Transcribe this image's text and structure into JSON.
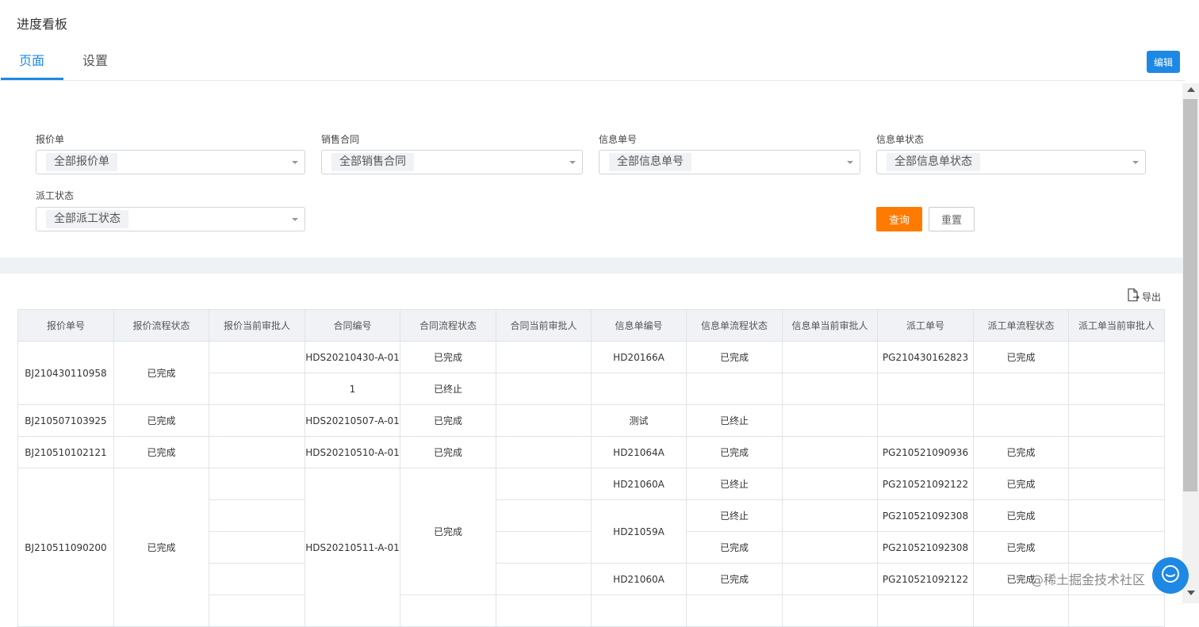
{
  "page_title": "进度看板",
  "tabs": [
    {
      "label": "页面",
      "active": true
    },
    {
      "label": "设置",
      "active": false
    }
  ],
  "edit_label": "编辑",
  "filters": {
    "quote": {
      "label": "报价单",
      "value": "全部报价单"
    },
    "contract": {
      "label": "销售合同",
      "value": "全部销售合同"
    },
    "info_no": {
      "label": "信息单号",
      "value": "全部信息单号"
    },
    "info_status": {
      "label": "信息单状态",
      "value": "全部信息单状态"
    },
    "dispatch_status": {
      "label": "派工状态",
      "value": "全部派工状态"
    }
  },
  "query_label": "查询",
  "reset_label": "重置",
  "export_label": "导出",
  "accent_color": "#1e88e5",
  "query_color": "#ff7a00",
  "table": {
    "columns": [
      "报价单号",
      "报价流程状态",
      "报价当前审批人",
      "合同编号",
      "合同流程状态",
      "合同当前审批人",
      "信息单编号",
      "信息单流程状态",
      "信息单当前审批人",
      "派工单号",
      "派工单流程状态",
      "派工单当前审批人"
    ],
    "rows": [
      {
        "quote_no": "BJ210430110958",
        "quote_status": "已完成",
        "contracts": [
          {
            "no": "HDS20210430-A-01",
            "status": "已完成",
            "infos": [
              {
                "no": "HD20166A",
                "status": "已完成",
                "dispatches": [
                  {
                    "no": "PG210430162823",
                    "status": "已完成"
                  }
                ]
              }
            ]
          },
          {
            "no": "1",
            "status": "已终止",
            "infos": [
              {
                "no": "",
                "status": "",
                "dispatches": [
                  {
                    "no": "",
                    "status": ""
                  }
                ]
              }
            ]
          }
        ]
      },
      {
        "quote_no": "BJ210507103925",
        "quote_status": "已完成",
        "contracts": [
          {
            "no": "HDS20210507-A-01",
            "status": "已完成",
            "infos": [
              {
                "no": "测试",
                "status": "已终止",
                "dispatches": [
                  {
                    "no": "",
                    "status": ""
                  }
                ]
              }
            ]
          }
        ]
      },
      {
        "quote_no": "BJ210510102121",
        "quote_status": "已完成",
        "contracts": [
          {
            "no": "HDS20210510-A-01",
            "status": "已完成",
            "infos": [
              {
                "no": "HD21064A",
                "status": "已完成",
                "dispatches": [
                  {
                    "no": "PG210521090936",
                    "status": "已完成"
                  }
                ]
              }
            ]
          }
        ]
      },
      {
        "quote_no": "BJ210511090200",
        "quote_status": "已完成",
        "contracts": [
          {
            "no": "HDS20210511-A-01",
            "status": "已完成",
            "infos": [
              {
                "no": "HD21060A",
                "status": "已终止",
                "dispatches": [
                  {
                    "no": "PG210521092122",
                    "status": "已完成"
                  }
                ]
              },
              {
                "no": "HD21059A",
                "status": "已终止",
                "dispatches": [
                  {
                    "no": "PG210521092308",
                    "status": "已完成"
                  }
                ]
              },
              {
                "no": "",
                "status": "已完成",
                "dispatches": [
                  {
                    "no": "PG210521092308",
                    "status": "已完成"
                  }
                ]
              },
              {
                "no": "HD21060A",
                "status": "已完成",
                "dispatches": [
                  {
                    "no": "PG210521092122",
                    "status": "已完成"
                  }
                ]
              }
            ]
          }
        ]
      }
    ]
  },
  "watermark": "@稀土掘金技术社区"
}
